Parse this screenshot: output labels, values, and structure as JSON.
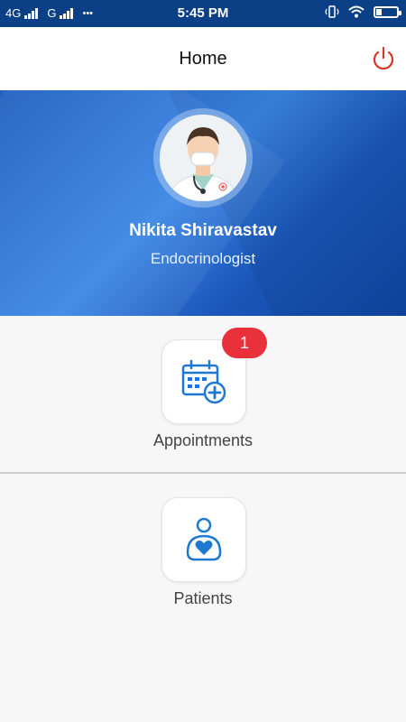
{
  "status_bar": {
    "network_1": "4G",
    "network_2": "G",
    "more_dots": "•••",
    "time": "5:45 PM"
  },
  "app_bar": {
    "title": "Home",
    "power_icon": "power-icon"
  },
  "profile": {
    "name": "Nikita Shiravastav",
    "specialty": "Endocrinologist"
  },
  "menu": {
    "appointments": {
      "label": "Appointments",
      "badge": "1",
      "icon": "calendar-plus-icon"
    },
    "patients": {
      "label": "Patients",
      "icon": "person-heart-icon"
    }
  },
  "colors": {
    "status_bar": "#0b3f86",
    "hero_blue": "#2f73d6",
    "accent_red": "#e8313a",
    "icon_blue": "#1e78d2"
  }
}
